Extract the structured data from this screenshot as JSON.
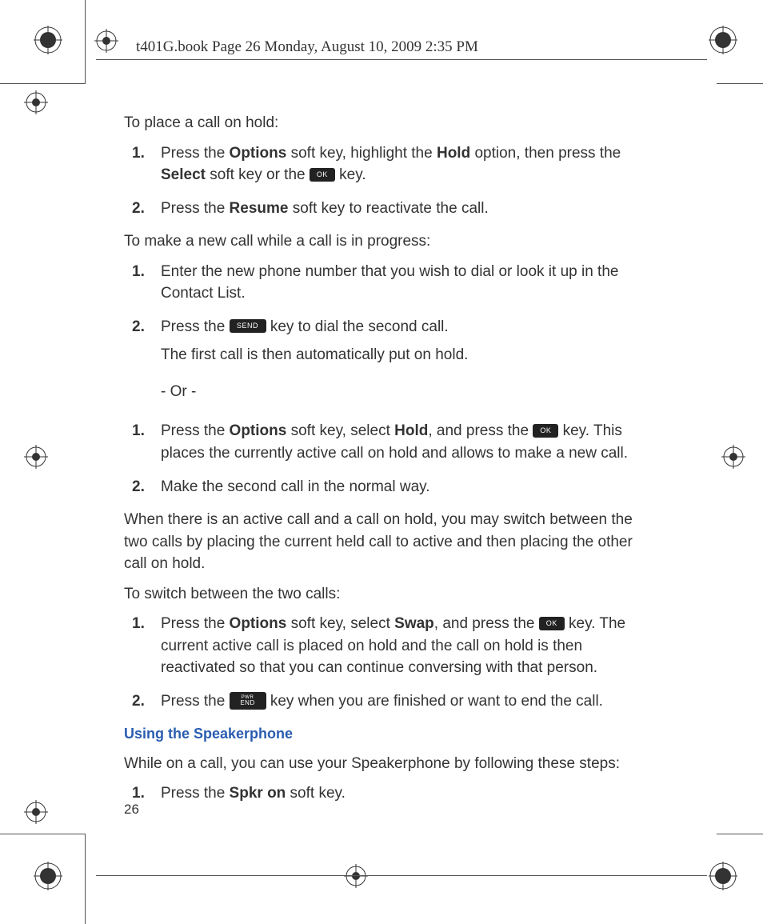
{
  "header": "t401G.book  Page 26  Monday, August 10, 2009  2:35 PM",
  "page_number": "26",
  "keys": {
    "ok": "OK",
    "send": "SEND",
    "end_top": "PWR",
    "end_bot": "END"
  },
  "s1": {
    "intro": "To place a call on hold:",
    "i1_pre": "Press the ",
    "i1_b1": "Options",
    "i1_mid1": " soft key, highlight the ",
    "i1_b2": "Hold",
    "i1_mid2": " option, then press the ",
    "i1_b3": "Select",
    "i1_post1": " soft key or the ",
    "i1_post2": " key.",
    "i2_pre": "Press the ",
    "i2_b1": "Resume",
    "i2_post": " soft key to reactivate the call."
  },
  "s2": {
    "intro": "To make a new call while a call is in progress:",
    "i1": "Enter the new phone number that you wish to dial or look it up in the Contact List.",
    "i2_pre": "Press the ",
    "i2_post": " key to dial the second call.",
    "i2_sub": "The first call is then automatically put on hold.",
    "or": "- Or -",
    "i3_pre": "Press the ",
    "i3_b1": "Options",
    "i3_mid1": " soft key, select ",
    "i3_b2": "Hold",
    "i3_mid2": ", and press the ",
    "i3_post": " key. This places the currently active call on hold and allows to make a new call.",
    "i4": "Make the second call in the normal way."
  },
  "s3": {
    "para": "When there is an active call and a call on hold, you may switch between the two calls by placing the current held call to active and then placing the other call on hold.",
    "intro": "To switch between the two calls:",
    "i1_pre": "Press the ",
    "i1_b1": "Options",
    "i1_mid1": " soft key, select ",
    "i1_b2": "Swap",
    "i1_mid2": ", and press the ",
    "i1_post": " key. The current active call is placed on hold and the call on hold is then reactivated so that you can continue conversing with that person.",
    "i2_pre": "Press the ",
    "i2_post": " key when you are finished or want to end the call."
  },
  "s4": {
    "head": "Using the Speakerphone",
    "intro": "While on a call, you can use your Speakerphone by following these steps:",
    "i1_pre": "Press the ",
    "i1_b1": "Spkr on",
    "i1_post": " soft key."
  }
}
